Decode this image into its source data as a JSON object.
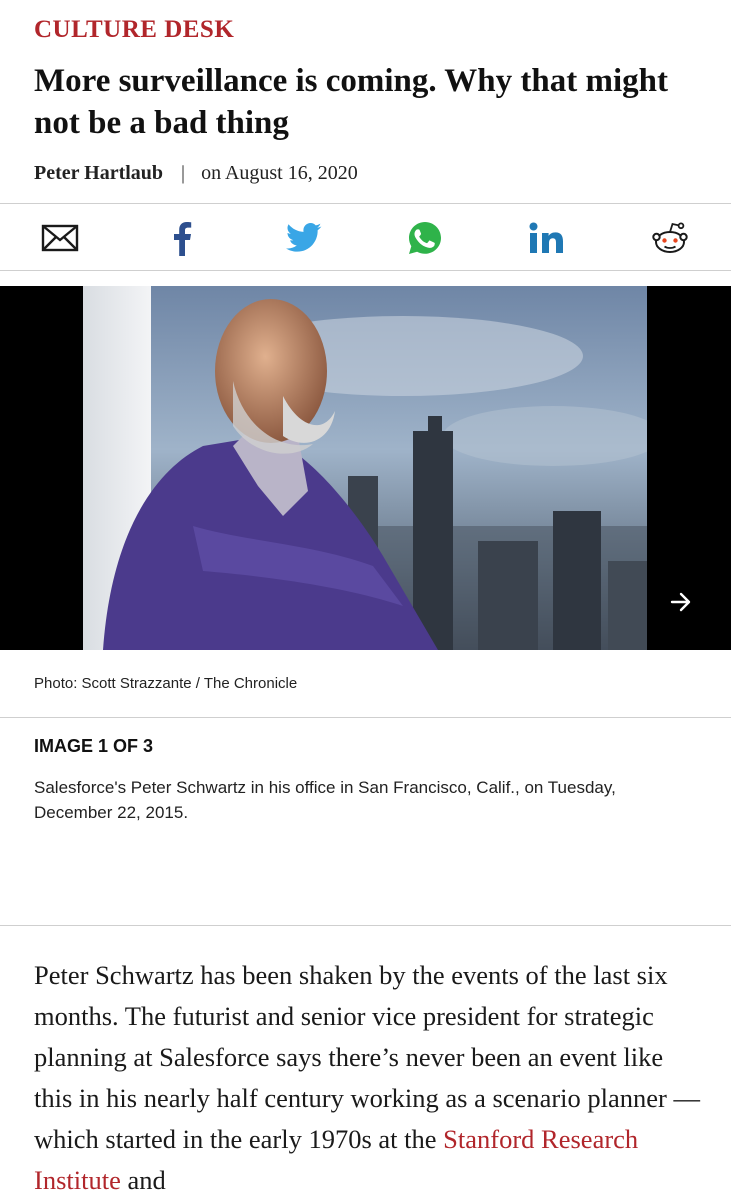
{
  "article": {
    "section": "CULTURE DESK",
    "headline": "More surveillance is coming. Why that might not be a bad thing",
    "author": "Peter Hartlaub",
    "separator": "|",
    "date": "on August 16, 2020"
  },
  "share": {
    "icons": [
      "email-icon",
      "facebook-icon",
      "twitter-icon",
      "whatsapp-icon",
      "linkedin-icon",
      "reddit-icon"
    ],
    "colors": {
      "email": "#1a1a1a",
      "facebook": "#2d4f8e",
      "twitter": "#39a6e6",
      "whatsapp": "#2fb34a",
      "linkedin": "#1f78b4",
      "reddit": "#1a1a1a"
    }
  },
  "gallery": {
    "credit": "Photo: Scott Strazzante / The Chronicle",
    "counter": "IMAGE 1 OF 3",
    "caption": "Salesforce's Peter Schwartz in his office in San Francisco, Calif., on Tuesday, December 22, 2015.",
    "next_icon": "arrow-right-icon"
  },
  "body": {
    "text_before_link": "Peter Schwartz has been shaken by the events of the last six months. The futurist and senior vice president for strategic planning at Salesforce says there’s never been an event like this in his nearly half century working as a scenario planner — which started in the early 1970s at the ",
    "link_text": "Stanford Research Institute",
    "text_after_link": " and"
  },
  "theme": {
    "accent": "#b1262b",
    "divider": "#cfcfcf"
  }
}
